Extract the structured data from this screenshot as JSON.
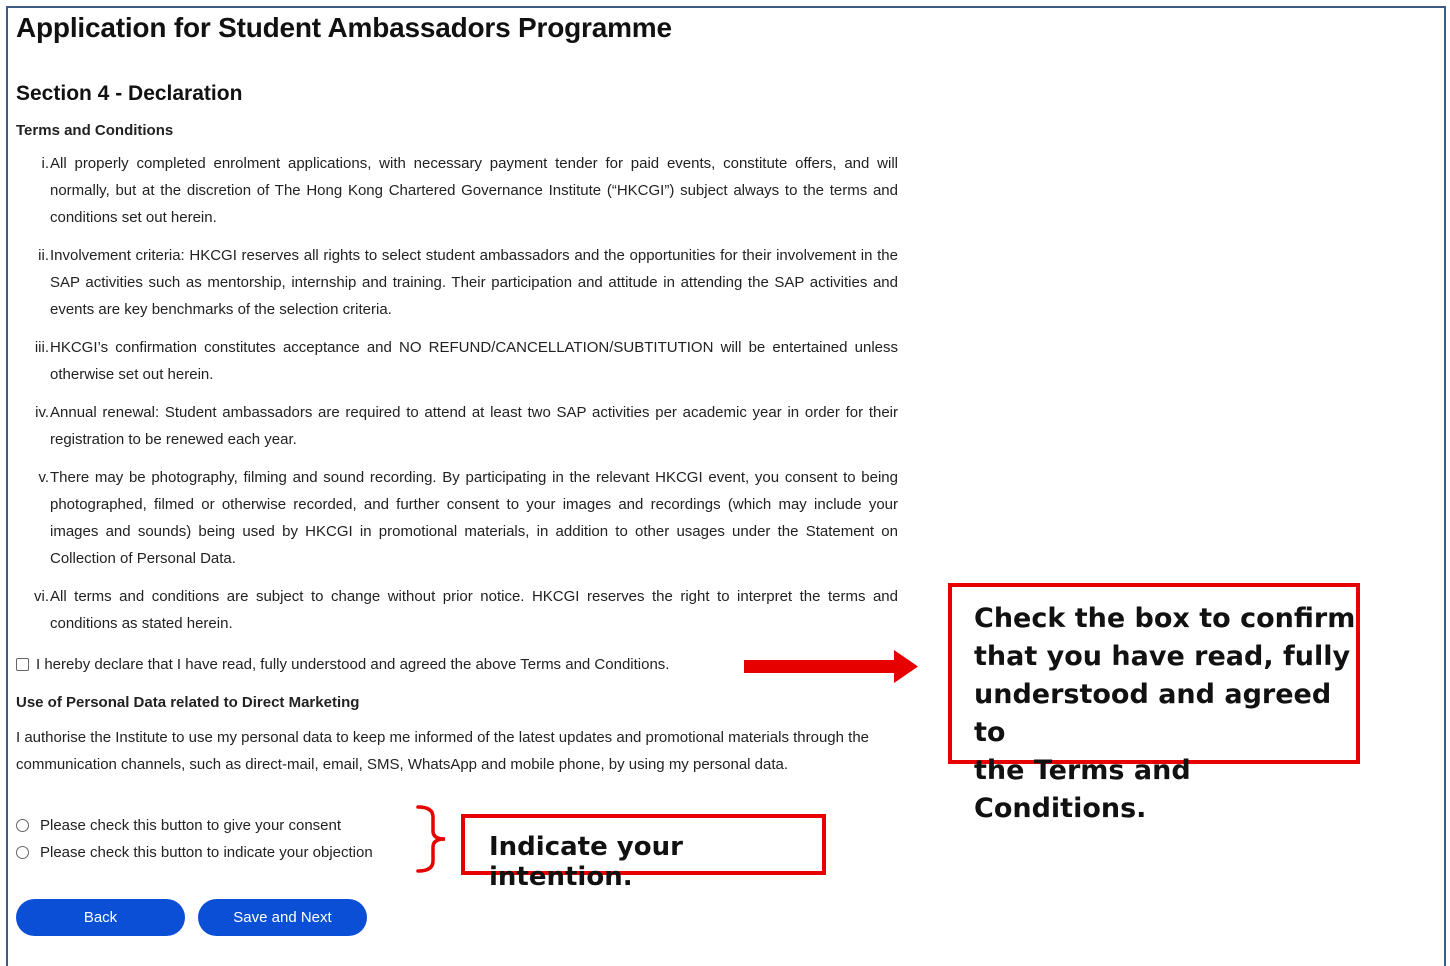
{
  "title": "Application for Student Ambassadors Programme",
  "section": "Section 4 - Declaration",
  "terms_heading": "Terms and Conditions",
  "terms": [
    {
      "num": "i.",
      "text": "All properly completed enrolment applications, with necessary payment tender for paid events, constitute offers, and will normally, but at the discretion of The Hong Kong Chartered Governance Institute (“HKCGI”) subject always to the terms and conditions set out herein."
    },
    {
      "num": "ii.",
      "text": "Involvement criteria: HKCGI reserves all rights to select student ambassadors and the opportunities for their involvement in the SAP activities such as mentorship, internship and training. Their participation and attitude in attending the SAP activities and events are key benchmarks of the selection criteria."
    },
    {
      "num": "iii.",
      "text": "HKCGI’s confirmation constitutes acceptance and NO REFUND/CANCELLATION/SUBTITUTION will be entertained unless otherwise set out herein."
    },
    {
      "num": "iv.",
      "text": "Annual renewal: Student ambassadors are required to attend at least two SAP activities per academic year in order for their registration to be renewed each year."
    },
    {
      "num": "v.",
      "text": "There may be photography, filming and sound recording. By participating in the relevant HKCGI event, you consent to being photographed, filmed or otherwise recorded, and further consent to your images and recordings (which may include your images and sounds) being used by HKCGI in promotional materials, in addition to other usages under the Statement on Collection of Personal Data."
    },
    {
      "num": "vi.",
      "text": "All terms and conditions are subject to change without prior notice. HKCGI reserves the right to interpret the terms and conditions as stated herein."
    }
  ],
  "declaration_label": "I hereby declare that I have read, fully understood and agreed the above Terms and Conditions.",
  "marketing_heading": "Use of Personal Data related to Direct Marketing",
  "marketing_text": "I authorise the Institute to use my personal data to keep me informed of the latest updates and promotional materials through the communication channels, such as direct-mail, email, SMS, WhatsApp and mobile phone, by using my personal data.",
  "consent_label": "Please check this button to give your consent",
  "objection_label": "Please check this button to indicate your objection",
  "buttons": {
    "back": "Back",
    "save_next": "Save and Next"
  },
  "annotations": {
    "checkbox_note": [
      "Check the box to confirm",
      "that you have read, fully",
      "understood and agreed to",
      "the Terms and Conditions."
    ],
    "radio_note": "Indicate your intention.",
    "annotation_color": "#e60000"
  },
  "colors": {
    "button_blue": "#0b4fd6",
    "frame_border": "#3d5a80"
  }
}
